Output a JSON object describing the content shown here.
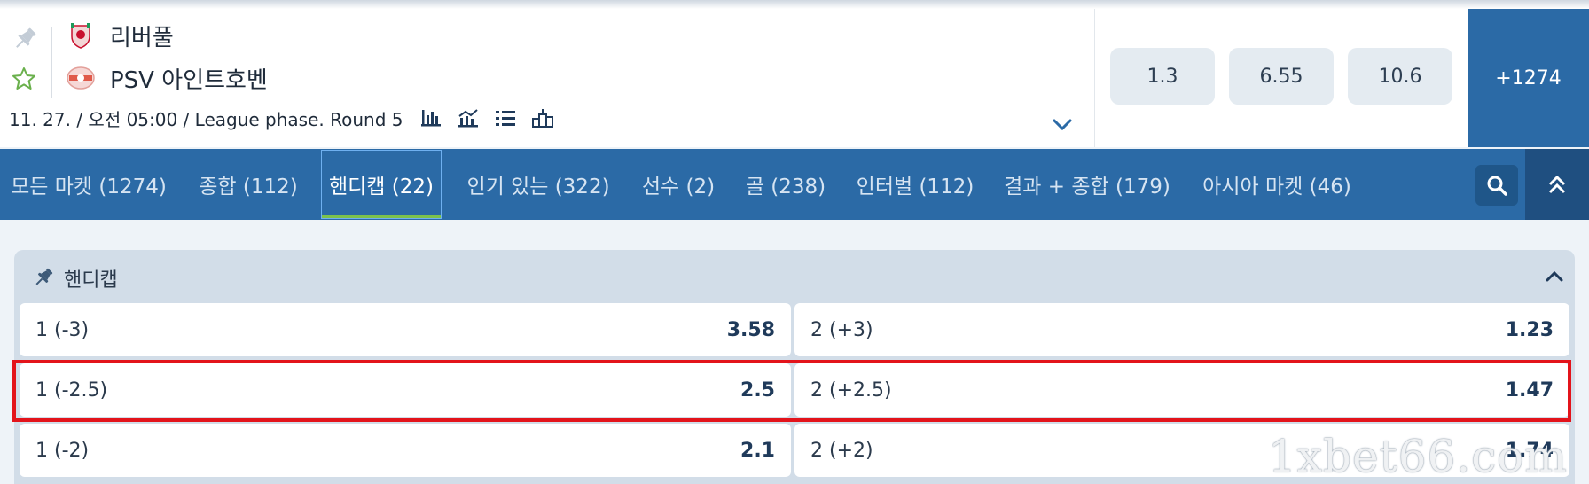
{
  "match": {
    "team1": "리버풀",
    "team2": "PSV 아인트호벤",
    "info": "11. 27. / 오전 05:00 / League phase. Round 5",
    "info_icons": [
      "bar-chart-icon",
      "trend-chart-icon",
      "list-icon",
      "podium-icon"
    ],
    "odds": [
      "1.3",
      "6.55",
      "10.6"
    ],
    "more_markets": "+1274"
  },
  "tabs": [
    {
      "label": "모든 마켓 (1274)"
    },
    {
      "label": "종합 (112)"
    },
    {
      "label": "핸디캡 (22)",
      "active": true
    },
    {
      "label": "인기 있는 (322)"
    },
    {
      "label": "선수 (2)"
    },
    {
      "label": "골 (238)"
    },
    {
      "label": "인터벌 (112)"
    },
    {
      "label": "결과 + 종합 (179)"
    },
    {
      "label": "아시아 마켓 (46)"
    }
  ],
  "market": {
    "title": "핸디캡",
    "rows": [
      {
        "left_label": "1 (-3)",
        "left_odd": "3.58",
        "right_label": "2 (+3)",
        "right_odd": "1.23"
      },
      {
        "left_label": "1 (-2.5)",
        "left_odd": "2.5",
        "right_label": "2 (+2.5)",
        "right_odd": "1.47",
        "highlighted": true
      },
      {
        "left_label": "1 (-2)",
        "left_odd": "2.1",
        "right_label": "2 (+2)",
        "right_odd": "1.74"
      }
    ]
  },
  "watermark": "1xbet66.com",
  "colors": {
    "brand_blue": "#2b6aa6",
    "active_tab_underline": "#7cc24c",
    "highlight_red": "#e3141b",
    "odd_button_bg": "#e4ebf1"
  }
}
